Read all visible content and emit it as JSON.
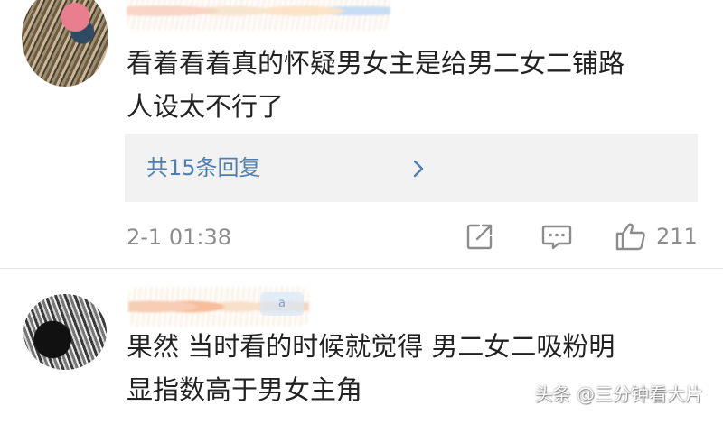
{
  "comments": [
    {
      "text_lines": [
        "看着看着真的怀疑男女主是给男二女二铺路",
        "人设太不行了"
      ],
      "replies_label": "共15条回复",
      "timestamp": "2-1 01:38",
      "like_count": "211",
      "icons": [
        "share-icon",
        "reply-icon",
        "thumbs-up-icon"
      ]
    },
    {
      "badge": "a",
      "text_lines": [
        "果然 当时看的时候就觉得 男二女二吸粉明",
        "显指数高于男女主角"
      ]
    }
  ],
  "watermark": "头条 @三分钟看大片",
  "colors": {
    "link": "#4e7eb0",
    "meta": "#8c8c8c",
    "reply_box": "#f2f2f2",
    "text": "#222222"
  }
}
